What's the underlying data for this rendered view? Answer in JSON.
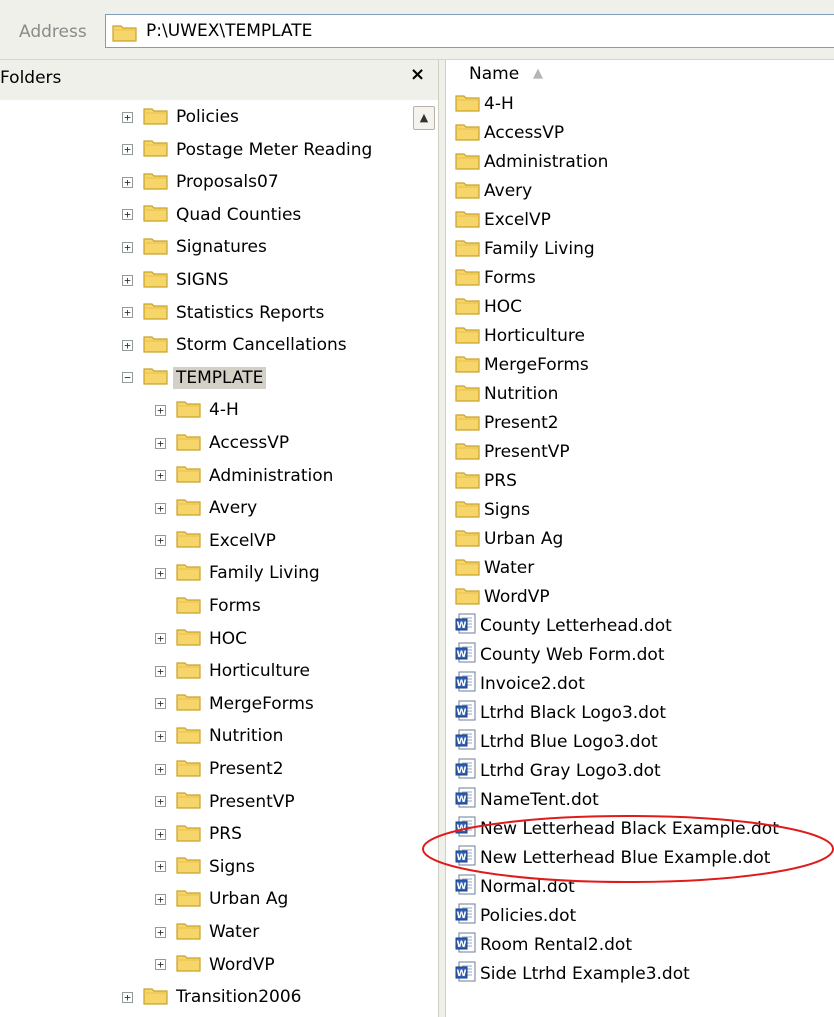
{
  "address": {
    "label": "Address",
    "path": "P:\\UWEX\\TEMPLATE"
  },
  "folders_pane": {
    "title": "Folders",
    "close_glyph": "×"
  },
  "tree": [
    {
      "label": "Policies",
      "expander": "+",
      "depth": 0
    },
    {
      "label": "Postage Meter Reading",
      "expander": "+",
      "depth": 0
    },
    {
      "label": "Proposals07",
      "expander": "+",
      "depth": 0
    },
    {
      "label": "Quad Counties",
      "expander": "+",
      "depth": 0
    },
    {
      "label": "Signatures",
      "expander": "+",
      "depth": 0
    },
    {
      "label": "SIGNS",
      "expander": "+",
      "depth": 0
    },
    {
      "label": "Statistics Reports",
      "expander": "+",
      "depth": 0
    },
    {
      "label": "Storm Cancellations",
      "expander": "+",
      "depth": 0
    },
    {
      "label": "TEMPLATE",
      "expander": "−",
      "depth": 0,
      "selected": true
    },
    {
      "label": "4-H",
      "expander": "+",
      "depth": 1
    },
    {
      "label": "AccessVP",
      "expander": "+",
      "depth": 1
    },
    {
      "label": "Administration",
      "expander": "+",
      "depth": 1
    },
    {
      "label": "Avery",
      "expander": "+",
      "depth": 1
    },
    {
      "label": "ExcelVP",
      "expander": "+",
      "depth": 1
    },
    {
      "label": "Family Living",
      "expander": "+",
      "depth": 1
    },
    {
      "label": "Forms",
      "expander": "",
      "depth": 1
    },
    {
      "label": "HOC",
      "expander": "+",
      "depth": 1
    },
    {
      "label": "Horticulture",
      "expander": "+",
      "depth": 1
    },
    {
      "label": "MergeForms",
      "expander": "+",
      "depth": 1
    },
    {
      "label": "Nutrition",
      "expander": "+",
      "depth": 1
    },
    {
      "label": "Present2",
      "expander": "+",
      "depth": 1
    },
    {
      "label": "PresentVP",
      "expander": "+",
      "depth": 1
    },
    {
      "label": "PRS",
      "expander": "+",
      "depth": 1
    },
    {
      "label": "Signs",
      "expander": "+",
      "depth": 1
    },
    {
      "label": "Urban Ag",
      "expander": "+",
      "depth": 1
    },
    {
      "label": "Water",
      "expander": "+",
      "depth": 1
    },
    {
      "label": "WordVP",
      "expander": "+",
      "depth": 1
    },
    {
      "label": "Transition2006",
      "expander": "+",
      "depth": 0
    }
  ],
  "filelist": {
    "column_name": "Name",
    "sort_glyph": "▲",
    "items": [
      {
        "name": "4-H",
        "type": "folder"
      },
      {
        "name": "AccessVP",
        "type": "folder"
      },
      {
        "name": "Administration",
        "type": "folder"
      },
      {
        "name": "Avery",
        "type": "folder"
      },
      {
        "name": "ExcelVP",
        "type": "folder"
      },
      {
        "name": "Family Living",
        "type": "folder"
      },
      {
        "name": "Forms",
        "type": "folder"
      },
      {
        "name": "HOC",
        "type": "folder"
      },
      {
        "name": "Horticulture",
        "type": "folder"
      },
      {
        "name": "MergeForms",
        "type": "folder"
      },
      {
        "name": "Nutrition",
        "type": "folder"
      },
      {
        "name": "Present2",
        "type": "folder"
      },
      {
        "name": "PresentVP",
        "type": "folder"
      },
      {
        "name": "PRS",
        "type": "folder"
      },
      {
        "name": "Signs",
        "type": "folder"
      },
      {
        "name": "Urban Ag",
        "type": "folder"
      },
      {
        "name": "Water",
        "type": "folder"
      },
      {
        "name": "WordVP",
        "type": "folder"
      },
      {
        "name": "County Letterhead.dot",
        "type": "word-template"
      },
      {
        "name": "County Web Form.dot",
        "type": "word-template"
      },
      {
        "name": "Invoice2.dot",
        "type": "word-template"
      },
      {
        "name": "Ltrhd Black Logo3.dot",
        "type": "word-template"
      },
      {
        "name": "Ltrhd Blue Logo3.dot",
        "type": "word-template"
      },
      {
        "name": "Ltrhd Gray Logo3.dot",
        "type": "word-template"
      },
      {
        "name": "NameTent.dot",
        "type": "word-template"
      },
      {
        "name": "New Letterhead Black Example.dot",
        "type": "word-template",
        "circled": true
      },
      {
        "name": "New Letterhead Blue Example.dot",
        "type": "word-template",
        "circled": true
      },
      {
        "name": "Normal.dot",
        "type": "word-template"
      },
      {
        "name": "Policies.dot",
        "type": "word-template"
      },
      {
        "name": "Room Rental2.dot",
        "type": "word-template"
      },
      {
        "name": "Side Ltrhd Example3.dot",
        "type": "word-template"
      }
    ]
  },
  "colors": {
    "folder_fill": "#f6d66a",
    "folder_stroke": "#c9a227",
    "doc_blue": "#2b5fb8",
    "highlight_ring": "#e01b1b",
    "selection": "#d4d0c8"
  },
  "icons": {
    "folder": "folder-icon",
    "word_template": "word-document-icon",
    "scroll_up": "scroll-up-arrow-icon"
  }
}
